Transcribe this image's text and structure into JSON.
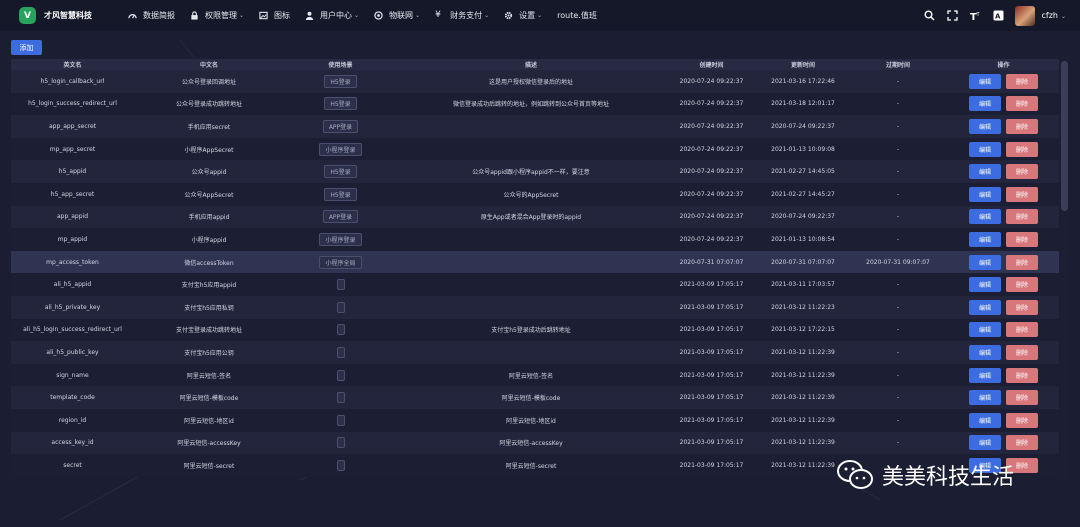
{
  "brand": {
    "logo_letter": "V",
    "name": "才风智慧科技"
  },
  "nav": [
    {
      "label": "数据简报",
      "icon": "dashboard-icon",
      "has_caret": false
    },
    {
      "label": "权限管理",
      "icon": "lock-icon",
      "has_caret": true
    },
    {
      "label": "图标",
      "icon": "picture-icon",
      "has_caret": false
    },
    {
      "label": "用户中心",
      "icon": "user-icon",
      "has_caret": true
    },
    {
      "label": "物联网",
      "icon": "iot-icon",
      "has_caret": true
    },
    {
      "label": "财务支付",
      "icon": "yen-icon",
      "has_caret": true
    },
    {
      "label": "设置",
      "icon": "gear-icon",
      "has_caret": true
    },
    {
      "label": "route.值班",
      "icon": "",
      "has_caret": false
    }
  ],
  "tools": [
    "search-icon",
    "fullscreen-icon",
    "font-size-icon",
    "translate-icon"
  ],
  "user": {
    "name": "cfzh"
  },
  "toolbar": {
    "add_label": "添加"
  },
  "columns": [
    "英文名",
    "中文名",
    "使用场景",
    "描述",
    "创建时间",
    "更新时间",
    "过期时间",
    "操作"
  ],
  "actions": {
    "edit": "编辑",
    "delete": "删除"
  },
  "rows": [
    {
      "en": "h5_login_callback_url",
      "cn": "公众号登录回调地址",
      "scene": "H5登录",
      "desc": "这是用户授权微信登录后的地址",
      "created": "2020-07-24 09:22:37",
      "updated": "2021-03-16 17:22:46",
      "expire": "-"
    },
    {
      "en": "h5_login_success_redirect_url",
      "cn": "公众号登录成功跳转地址",
      "scene": "H5登录",
      "desc": "微信登录成功后跳转的地址，例如跳转到公众号首页等地址",
      "created": "2020-07-24 09:22:37",
      "updated": "2021-03-18 12:01:17",
      "expire": "-"
    },
    {
      "en": "app_app_secret",
      "cn": "手机应用secret",
      "scene": "APP登录",
      "desc": "",
      "created": "2020-07-24 09:22:37",
      "updated": "2020-07-24 09:22:37",
      "expire": "-"
    },
    {
      "en": "mp_app_secret",
      "cn": "小程序AppSecret",
      "scene": "小程序登录",
      "desc": "",
      "created": "2020-07-24 09:22:37",
      "updated": "2021-01-13 10:09:08",
      "expire": "-"
    },
    {
      "en": "h5_appid",
      "cn": "公众号appid",
      "scene": "H5登录",
      "desc": "公众号appid跟小程序appid不一样，要注意",
      "created": "2020-07-24 09:22:37",
      "updated": "2021-02-27 14:45:05",
      "expire": "-"
    },
    {
      "en": "h5_app_secret",
      "cn": "公众号AppSecret",
      "scene": "H5登录",
      "desc": "公众号的AppSecret",
      "created": "2020-07-24 09:22:37",
      "updated": "2021-02-27 14:45:27",
      "expire": "-"
    },
    {
      "en": "app_appid",
      "cn": "手机应用appid",
      "scene": "APP登录",
      "desc": "原生App或者混合App登录时的appid",
      "created": "2020-07-24 09:22:37",
      "updated": "2020-07-24 09:22:37",
      "expire": "-"
    },
    {
      "en": "mp_appid",
      "cn": "小程序appid",
      "scene": "小程序登录",
      "desc": "",
      "created": "2020-07-24 09:22:37",
      "updated": "2021-01-13 10:08:54",
      "expire": "-"
    },
    {
      "en": "mp_access_token",
      "cn": "微信accessToken",
      "scene": "小程序全局",
      "desc": "",
      "created": "2020-07-31 07:07:07",
      "updated": "2020-07-31 07:07:07",
      "expire": "2020-07-31 09:07:07"
    },
    {
      "en": "ali_h5_appid",
      "cn": "支付宝h5应用appid",
      "scene": "",
      "desc": "",
      "created": "2021-03-09 17:05:17",
      "updated": "2021-03-11 17:03:57",
      "expire": "-"
    },
    {
      "en": "ali_h5_private_key",
      "cn": "支付宝h5应用私钥",
      "scene": "",
      "desc": "",
      "created": "2021-03-09 17:05:17",
      "updated": "2021-03-12 11:22:23",
      "expire": "-"
    },
    {
      "en": "ali_h5_login_success_redirect_url",
      "cn": "支付宝登录成功跳转地址",
      "scene": "",
      "desc": "支付宝h5登录成功后跳转地址",
      "created": "2021-03-09 17:05:17",
      "updated": "2021-03-12 17:22:15",
      "expire": "-"
    },
    {
      "en": "ali_h5_public_key",
      "cn": "支付宝h5应用公钥",
      "scene": "",
      "desc": "",
      "created": "2021-03-09 17:05:17",
      "updated": "2021-03-12 11:22:39",
      "expire": "-"
    },
    {
      "en": "sign_name",
      "cn": "阿里云短信-签名",
      "scene": "",
      "desc": "阿里云短信-签名",
      "created": "2021-03-09 17:05:17",
      "updated": "2021-03-12 11:22:39",
      "expire": "-"
    },
    {
      "en": "template_code",
      "cn": "阿里云短信-模板code",
      "scene": "",
      "desc": "阿里云短信-模板code",
      "created": "2021-03-09 17:05:17",
      "updated": "2021-03-12 11:22:39",
      "expire": "-"
    },
    {
      "en": "region_id",
      "cn": "阿里云短信-地区id",
      "scene": "",
      "desc": "阿里云短信-地区id",
      "created": "2021-03-09 17:05:17",
      "updated": "2021-03-12 11:22:39",
      "expire": "-"
    },
    {
      "en": "access_key_id",
      "cn": "阿里云短信-accessKey",
      "scene": "",
      "desc": "阿里云短信-accessKey",
      "created": "2021-03-09 17:05:17",
      "updated": "2021-03-12 11:22:39",
      "expire": "-"
    },
    {
      "en": "secret",
      "cn": "阿里云短信-secret",
      "scene": "",
      "desc": "阿里云短信-secret",
      "created": "2021-03-09 17:05:17",
      "updated": "2021-03-12 11:22:39",
      "expire": "-"
    }
  ],
  "highlighted_row": 8,
  "watermark": {
    "text": "美美科技生活",
    "icon": "wechat-icon"
  },
  "colors": {
    "primary": "#3d6ce0",
    "danger": "#d8777b",
    "background": "#1b1e33",
    "topbar": "#151829",
    "brand_green": "#27a35d"
  }
}
